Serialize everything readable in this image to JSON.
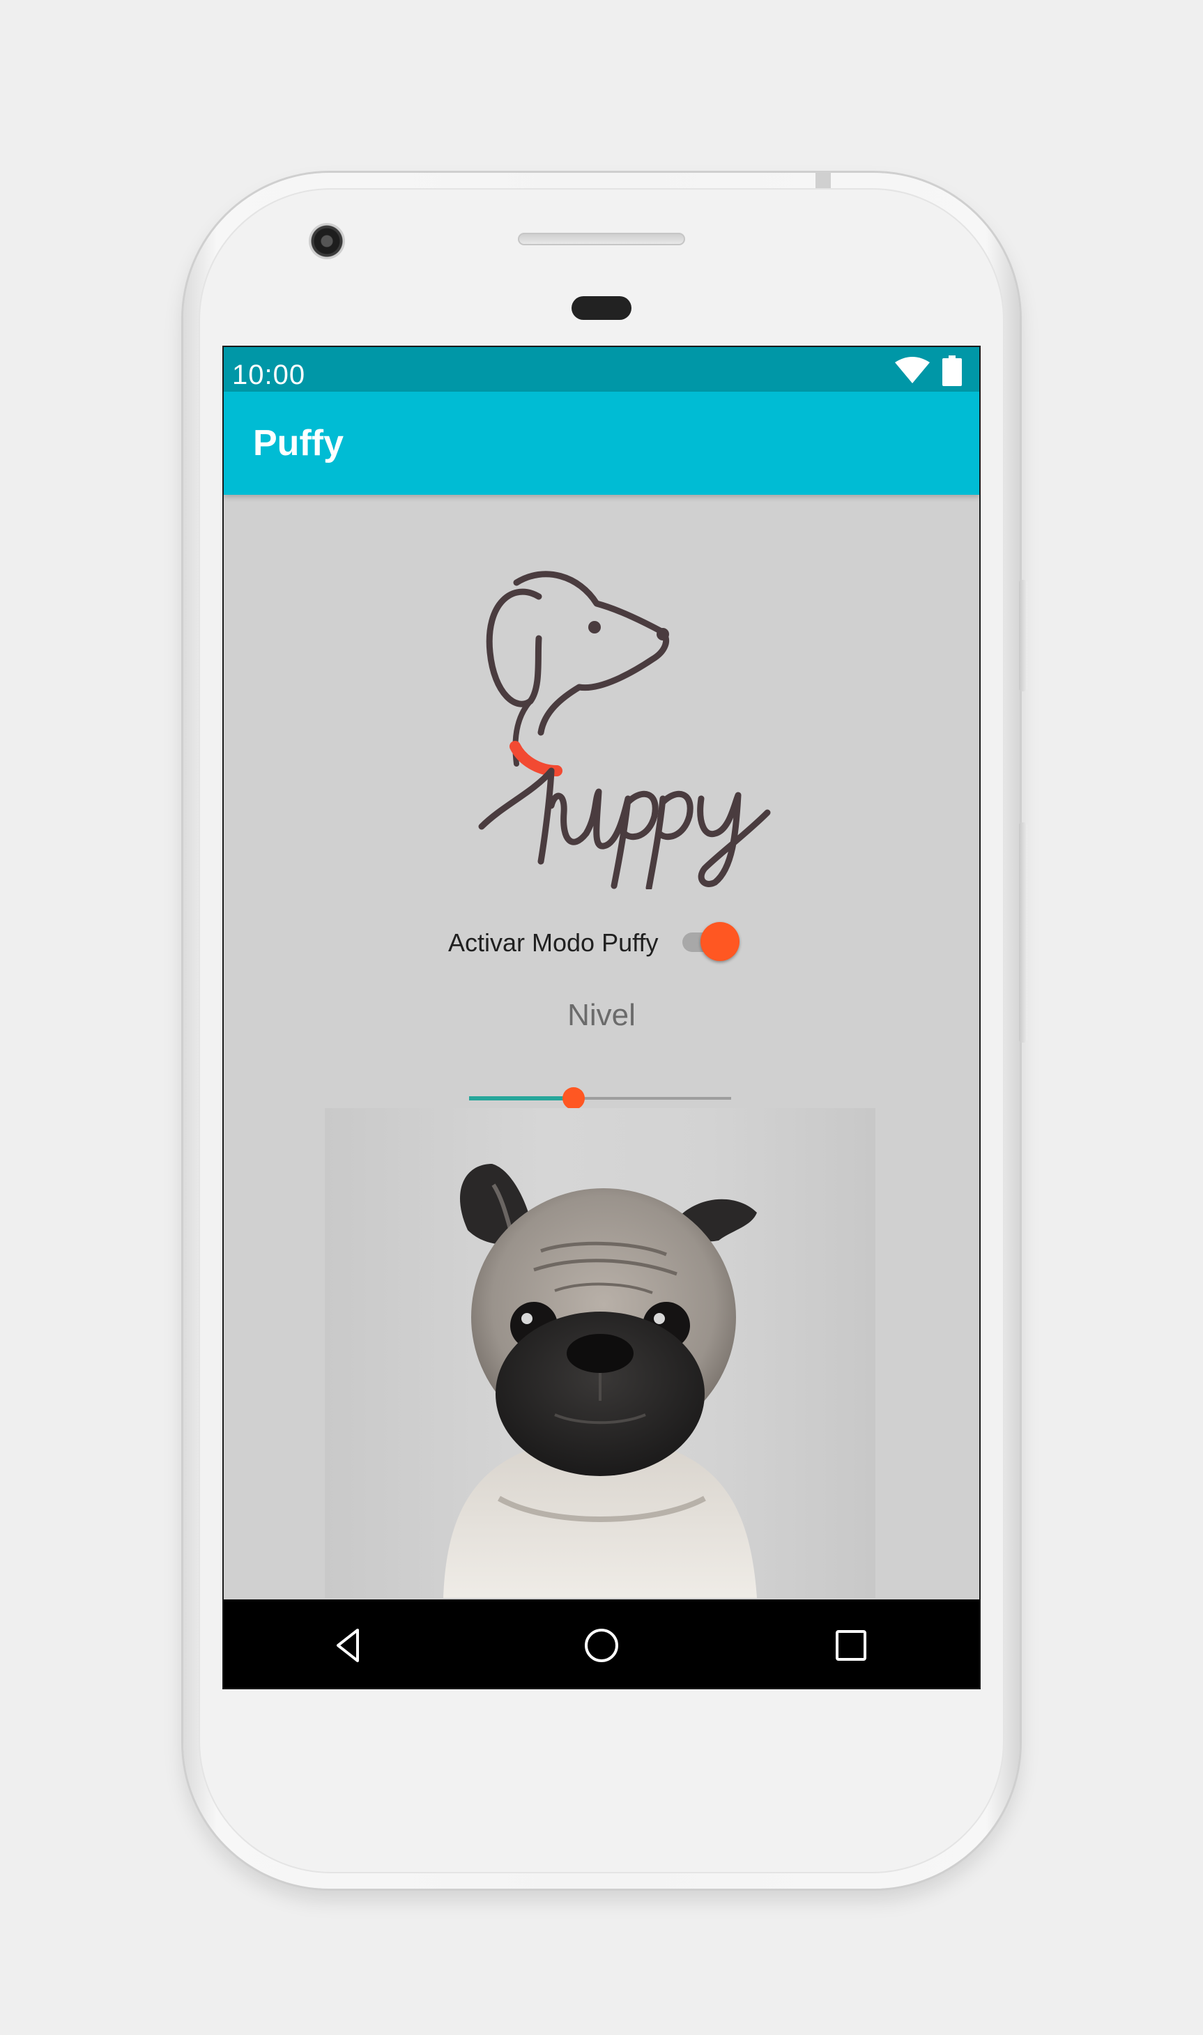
{
  "status_bar": {
    "time": "10:00",
    "icons": [
      "wifi-icon",
      "battery-icon"
    ]
  },
  "app_bar": {
    "title": "Puffy"
  },
  "logo": {
    "text": "Puppy",
    "icon": "dog-logo-icon"
  },
  "mode_toggle": {
    "label": "Activar Modo Puffy",
    "checked": true
  },
  "level": {
    "label": "Nivel",
    "value_fraction": 0.4
  },
  "nav_bar": {
    "buttons": [
      "back-icon",
      "home-icon",
      "recents-icon"
    ]
  },
  "colors": {
    "status_bar": "#0097a7",
    "app_bar": "#00bcd4",
    "accent": "#ff5722",
    "slider_fill": "#26a69a",
    "screen_background": "#d0d0d0"
  }
}
